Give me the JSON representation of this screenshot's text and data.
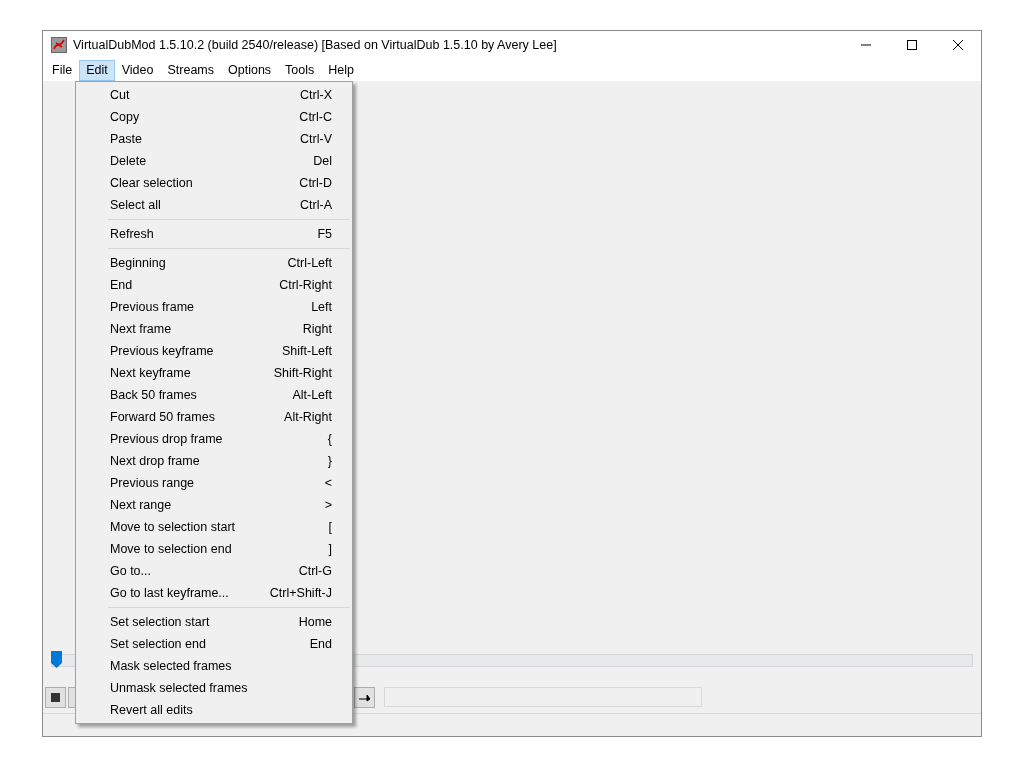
{
  "window": {
    "title": "VirtualDubMod 1.5.10.2 (build 2540/release) [Based on VirtualDub 1.5.10 by Avery Lee]"
  },
  "menu_bar": [
    {
      "label": "File",
      "selected": false
    },
    {
      "label": "Edit",
      "selected": true
    },
    {
      "label": "Video",
      "selected": false
    },
    {
      "label": "Streams",
      "selected": false
    },
    {
      "label": "Options",
      "selected": false
    },
    {
      "label": "Tools",
      "selected": false
    },
    {
      "label": "Help",
      "selected": false
    }
  ],
  "edit_menu": [
    [
      {
        "label": "Cut",
        "shortcut": "Ctrl-X"
      },
      {
        "label": "Copy",
        "shortcut": "Ctrl-C"
      },
      {
        "label": "Paste",
        "shortcut": "Ctrl-V"
      },
      {
        "label": "Delete",
        "shortcut": "Del"
      },
      {
        "label": "Clear selection",
        "shortcut": "Ctrl-D"
      },
      {
        "label": "Select all",
        "shortcut": "Ctrl-A"
      }
    ],
    [
      {
        "label": "Refresh",
        "shortcut": "F5"
      }
    ],
    [
      {
        "label": "Beginning",
        "shortcut": "Ctrl-Left"
      },
      {
        "label": "End",
        "shortcut": "Ctrl-Right"
      },
      {
        "label": "Previous frame",
        "shortcut": "Left"
      },
      {
        "label": "Next frame",
        "shortcut": "Right"
      },
      {
        "label": "Previous keyframe",
        "shortcut": "Shift-Left"
      },
      {
        "label": "Next keyframe",
        "shortcut": "Shift-Right"
      },
      {
        "label": "Back 50 frames",
        "shortcut": "Alt-Left"
      },
      {
        "label": "Forward 50 frames",
        "shortcut": "Alt-Right"
      },
      {
        "label": "Previous drop frame",
        "shortcut": "{"
      },
      {
        "label": "Next drop frame",
        "shortcut": "}"
      },
      {
        "label": "Previous range",
        "shortcut": "<"
      },
      {
        "label": "Next range",
        "shortcut": ">"
      },
      {
        "label": "Move to selection start",
        "shortcut": "["
      },
      {
        "label": "Move to selection end",
        "shortcut": "]"
      },
      {
        "label": "Go to...",
        "shortcut": "Ctrl-G"
      },
      {
        "label": "Go to last keyframe...",
        "shortcut": "Ctrl+Shift-J"
      }
    ],
    [
      {
        "label": "Set selection start",
        "shortcut": "Home"
      },
      {
        "label": "Set selection end",
        "shortcut": "End"
      },
      {
        "label": "Mask selected frames"
      },
      {
        "label": "Unmask selected frames"
      },
      {
        "label": "Revert all edits"
      }
    ]
  ],
  "position_slider": {
    "level": 0
  }
}
